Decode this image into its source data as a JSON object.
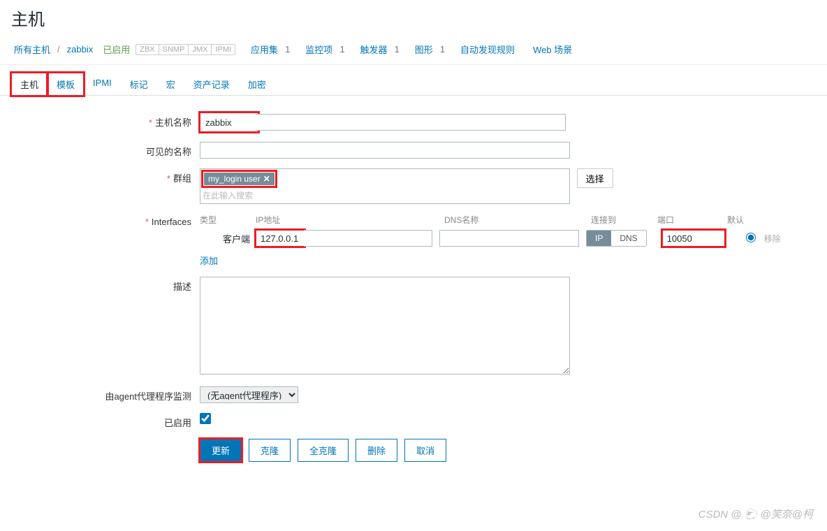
{
  "page_title": "主机",
  "breadcrumb": {
    "all_hosts": "所有主机",
    "current": "zabbix"
  },
  "status_enabled": "已启用",
  "proto_badges": [
    "ZBX",
    "SNMP",
    "JMX",
    "IPMI"
  ],
  "navlinks": {
    "apps": "应用集",
    "apps_count": "1",
    "items": "监控项",
    "items_count": "1",
    "triggers": "触发器",
    "triggers_count": "1",
    "graphs": "图形",
    "graphs_count": "1",
    "discovery": "自动发现规则",
    "web": "Web 场景"
  },
  "tabs": {
    "host": "主机",
    "template": "模板",
    "ipmi": "IPMI",
    "tags": "标记",
    "macros": "宏",
    "inventory": "资产记录",
    "encryption": "加密"
  },
  "labels": {
    "hostname": "主机名称",
    "visible_name": "可见的名称",
    "groups": "群组",
    "interfaces": "Interfaces",
    "description": "描述",
    "agent_proxy": "由agent代理程序监测",
    "enabled": "已启用"
  },
  "form": {
    "hostname": "zabbix",
    "visible_name": "",
    "group_tag": "my_login user",
    "group_placeholder": "在此输入搜索",
    "select_btn": "选择",
    "interfaces": {
      "headers": {
        "type": "类型",
        "ip": "IP地址",
        "dns": "DNS名称",
        "conn": "连接到",
        "port": "端口",
        "default": "默认"
      },
      "row": {
        "type_label": "客户端",
        "ip": "127.0.0.1",
        "dns": "",
        "conn_ip": "IP",
        "conn_dns": "DNS",
        "port": "10050",
        "remove": "移除"
      },
      "add": "添加"
    },
    "proxy_option": "(无agent代理程序)",
    "enabled_checked": true
  },
  "buttons": {
    "update": "更新",
    "clone": "克隆",
    "full_clone": "全克隆",
    "delete": "删除",
    "cancel": "取消"
  },
  "watermark": "CSDN @ 🐑 @笑奈@柯"
}
